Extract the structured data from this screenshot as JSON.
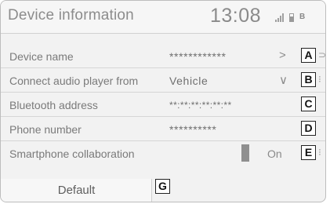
{
  "header": {
    "title": "Device information",
    "clock": "13:08",
    "bt_status": "B"
  },
  "rows": [
    {
      "label": "Device name",
      "value": "************",
      "control": "chevron-right",
      "control_glyph": ">",
      "callout": "A",
      "edge_glyph": "⊃"
    },
    {
      "label": "Connect audio player from",
      "value": "Vehicle",
      "control": "chevron-down",
      "control_glyph": "∨",
      "callout": "B",
      "edge_glyph": "⁝"
    },
    {
      "label": "Bluetooth address",
      "value": "**:**:**:**:**:**",
      "callout": "C"
    },
    {
      "label": "Phone number",
      "value": "**********",
      "callout": "D"
    },
    {
      "label": "Smartphone collaboration",
      "toggle": "On",
      "callout": "E",
      "edge_glyph": "⁝"
    }
  ],
  "default_button": {
    "label": "Default",
    "callout": "G"
  }
}
